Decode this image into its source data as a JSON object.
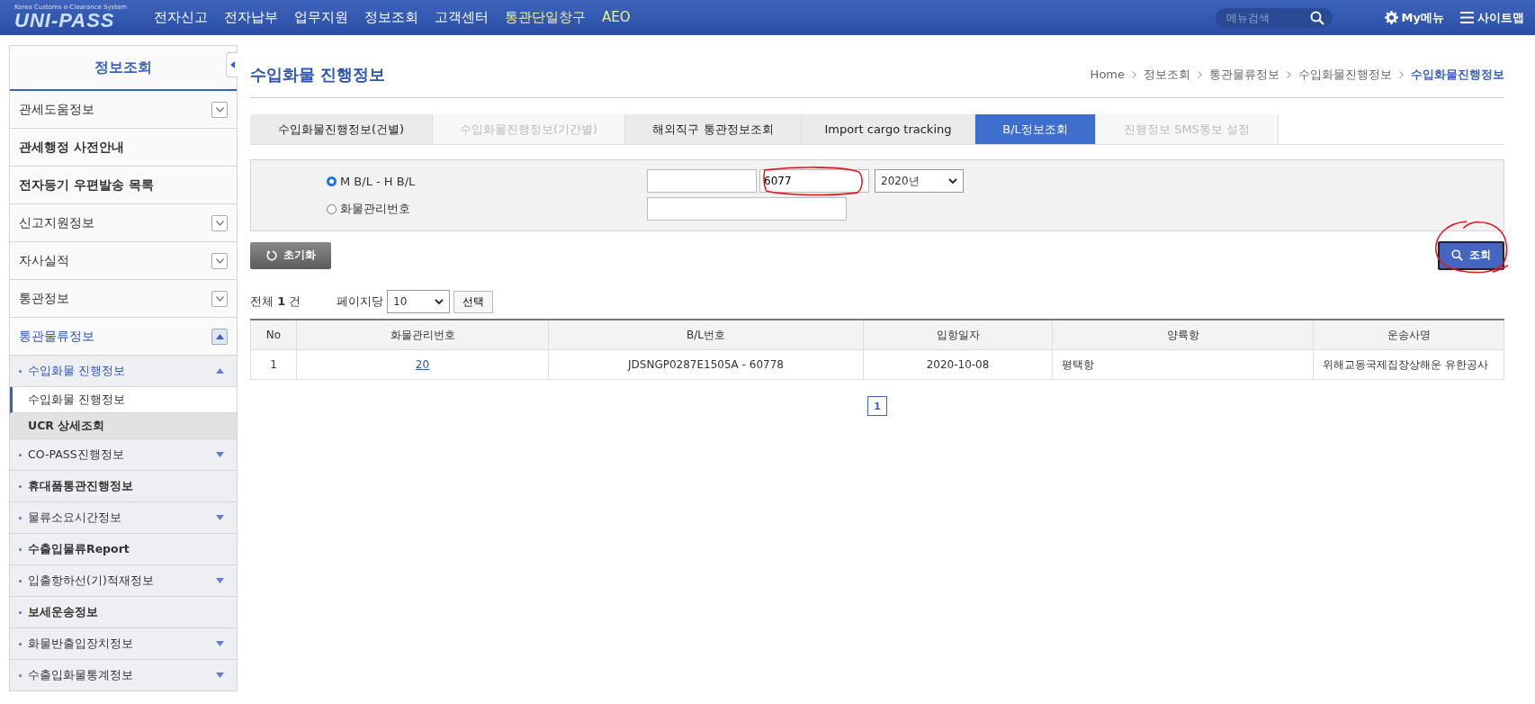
{
  "header": {
    "logo_tagline": "Korea Customs e-Clearance System",
    "logo": "UNI-PASS",
    "menu": [
      {
        "label": "전자신고",
        "highlight": false
      },
      {
        "label": "전자납부",
        "highlight": false
      },
      {
        "label": "업무지원",
        "highlight": false
      },
      {
        "label": "정보조회",
        "highlight": false
      },
      {
        "label": "고객센터",
        "highlight": false
      },
      {
        "label": "통관단일창구",
        "highlight": true
      },
      {
        "label": "AEO",
        "highlight": true
      }
    ],
    "search": {
      "placeholder": "메뉴검색"
    },
    "my_menu": "My메뉴",
    "sitemap": "사이트맵"
  },
  "sidebar": {
    "title": "정보조회",
    "items": [
      {
        "label": "관세도움정보",
        "kind": "group",
        "expanded": false
      },
      {
        "label": "관세행정 사전안내",
        "kind": "link"
      },
      {
        "label": "전자등기 우편발송 목록",
        "kind": "link"
      },
      {
        "label": "신고지원정보",
        "kind": "group",
        "expanded": false
      },
      {
        "label": "자사실적",
        "kind": "group",
        "expanded": false
      },
      {
        "label": "통관정보",
        "kind": "group",
        "expanded": false
      },
      {
        "label": "통관물류정보",
        "kind": "group",
        "expanded": true,
        "children": [
          {
            "label": "수입화물 진행정보",
            "kind": "sub",
            "expanded": true,
            "children": [
              {
                "label": "수입화물 진행정보",
                "selected": true
              },
              {
                "label": "UCR 상세조회",
                "selected": false
              }
            ]
          },
          {
            "label": "CO-PASS진행정보",
            "kind": "sub",
            "expanded": false
          },
          {
            "label": "휴대품통관진행정보",
            "kind": "sub-link"
          },
          {
            "label": "물류소요시간정보",
            "kind": "sub",
            "expanded": false
          },
          {
            "label": "수출입물류Report",
            "kind": "sub-link"
          },
          {
            "label": "입출항하선(기)적재정보",
            "kind": "sub",
            "expanded": false
          },
          {
            "label": "보세운송정보",
            "kind": "sub-link"
          },
          {
            "label": "화물반출입장치정보",
            "kind": "sub",
            "expanded": false
          },
          {
            "label": "수출입화물통계정보",
            "kind": "sub",
            "expanded": false
          }
        ]
      }
    ]
  },
  "page": {
    "title": "수입화물 진행정보",
    "breadcrumb": [
      {
        "label": "Home",
        "current": false
      },
      {
        "label": "정보조회",
        "current": false
      },
      {
        "label": "통관물류정보",
        "current": false
      },
      {
        "label": "수입화물진행정보",
        "current": false
      },
      {
        "label": "수입화물진행정보",
        "current": true
      }
    ]
  },
  "tabs": [
    {
      "label": "수입화물진행정보(건별)",
      "selected": false,
      "disabled": false
    },
    {
      "label": "수입화물진행정보(기간별)",
      "selected": false,
      "disabled": true
    },
    {
      "label": "해외직구 통관정보조회",
      "selected": false,
      "disabled": false
    },
    {
      "label": "Import cargo tracking",
      "selected": false,
      "disabled": false
    },
    {
      "label": "B/L정보조회",
      "selected": true,
      "disabled": false
    },
    {
      "label": "진행정보 SMS통보 설정",
      "selected": false,
      "disabled": true
    }
  ],
  "form": {
    "options": [
      {
        "label": "M B/L - H B/L",
        "selected": true
      },
      {
        "label": "화물관리번호",
        "selected": false
      }
    ],
    "hbl": {
      "value": "6077",
      "circled": true
    },
    "year": {
      "value": "2020년"
    },
    "reset": "초기화",
    "search": {
      "label": "조회",
      "circled": true
    }
  },
  "results": {
    "total_label": "전체",
    "total": "1",
    "unit": "건",
    "per_page_label": "페이지당",
    "per_page": "10",
    "apply": "선택",
    "columns": [
      "No",
      "화물관리번호",
      "B/L번호",
      "입항일자",
      "양륙항",
      "운송사명"
    ],
    "rows": [
      [
        "1",
        "20",
        "JDSNGP0287E1505A - 60778",
        "2020-10-08",
        "평택항",
        "위해교동국제집장상해운 유한공사"
      ]
    ]
  },
  "pagination": [
    {
      "label": "1",
      "selected": true
    }
  ]
}
